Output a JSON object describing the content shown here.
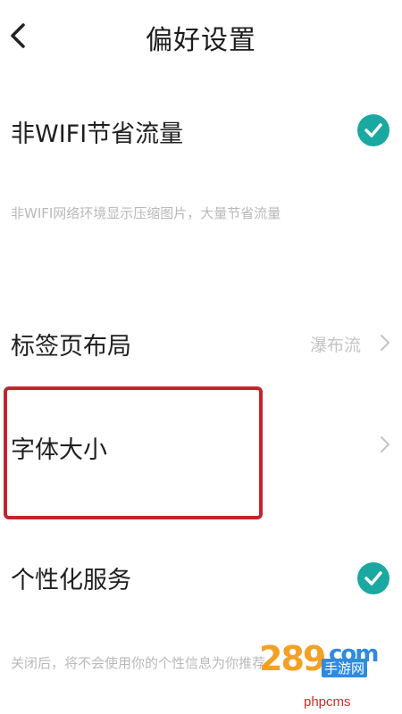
{
  "header": {
    "title": "偏好设置",
    "back_icon": "chevron-left-icon"
  },
  "settings": {
    "wifi_saving": {
      "label": "非WIFI节省流量",
      "checked": true,
      "description": "非WIFI网络环境显示压缩图片，大量节省流量"
    },
    "tab_layout": {
      "label": "标签页布局",
      "value": "瀑布流"
    },
    "font_size": {
      "label": "字体大小"
    },
    "personalized": {
      "label": "个性化服务",
      "checked": true,
      "description": "关闭后，将不会使用你的个性信息为你推荐"
    }
  },
  "watermark": {
    "brand": "289",
    "domain": "com",
    "sub": "手游网",
    "url": "phpcms"
  },
  "colors": {
    "accent": "#1aa8a0",
    "highlight": "#c4242e",
    "description_text": "#b9b9b9"
  }
}
